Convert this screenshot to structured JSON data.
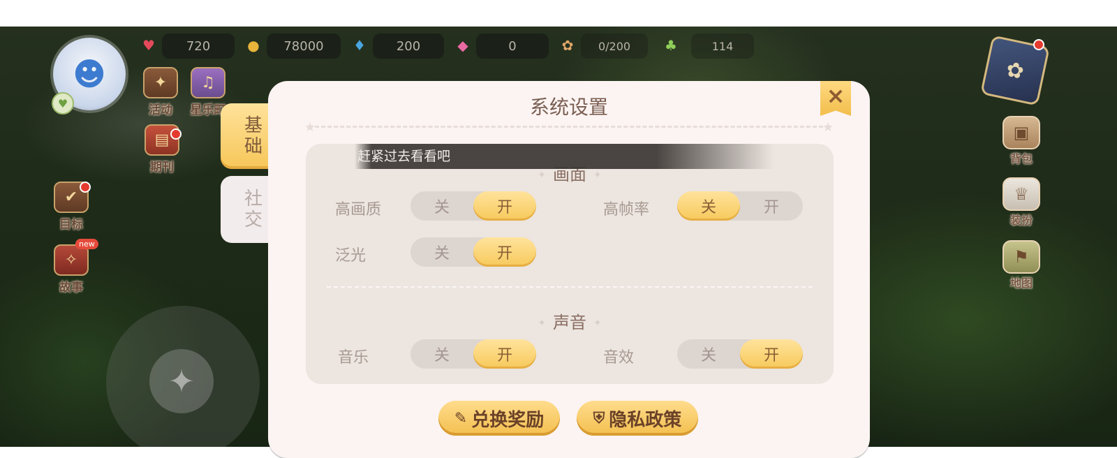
{
  "hud": {
    "hearts": "720",
    "coins": "78000",
    "potion": "200",
    "gems": "0",
    "pets": "0/200",
    "clover": "114"
  },
  "left_menu": [
    {
      "label": "活动",
      "icon": "activity-icon"
    },
    {
      "label": "星乐町",
      "icon": "town-icon"
    },
    {
      "label": "期刊",
      "icon": "newspaper-icon"
    },
    {
      "label": "目标",
      "icon": "target-icon"
    },
    {
      "label": "故事",
      "icon": "story-icon",
      "badge": "new"
    }
  ],
  "right_menu": [
    {
      "label": "背包",
      "icon": "backpack-icon"
    },
    {
      "label": "装扮",
      "icon": "outfit-icon"
    },
    {
      "label": "地图",
      "icon": "map-icon"
    }
  ],
  "tabs": [
    {
      "label": "基础",
      "active": true
    },
    {
      "label": "社交",
      "active": false
    }
  ],
  "dialog": {
    "title": "系统设置",
    "close_icon": "×",
    "toast": "赶紧过去看看吧",
    "graphics": {
      "title": "画面",
      "high_quality": {
        "label": "高画质",
        "off": "关",
        "on": "开",
        "value": "开"
      },
      "high_fps": {
        "label": "高帧率",
        "off": "关",
        "on": "开",
        "value": "关"
      },
      "bloom": {
        "label": "泛光",
        "off": "关",
        "on": "开",
        "value": "开"
      }
    },
    "sound": {
      "title": "声音",
      "music": {
        "label": "音乐",
        "off": "关",
        "on": "开",
        "value": "开"
      },
      "sfx": {
        "label": "音效",
        "off": "关",
        "on": "开",
        "value": "开"
      }
    },
    "buttons": {
      "redeem": "兑换奖励",
      "privacy": "隐私政策"
    }
  },
  "colors": {
    "accent_yellow": "#f7c95b",
    "dialog_bg": "#fbf4f2",
    "text_brown": "#7a5e52"
  }
}
